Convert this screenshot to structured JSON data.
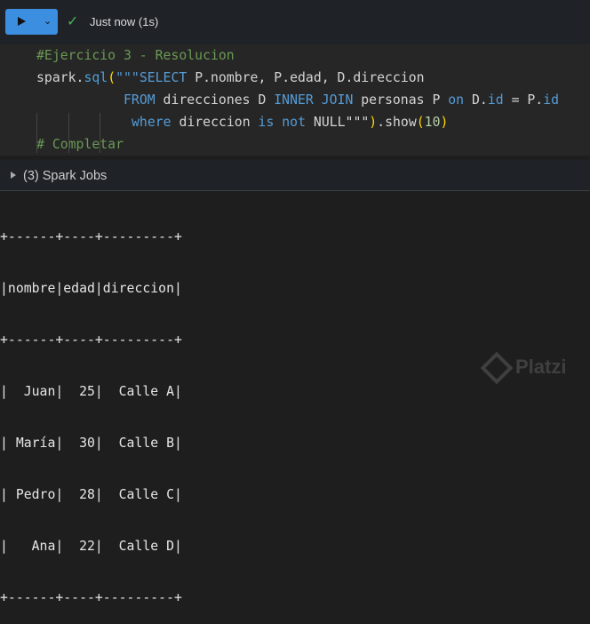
{
  "toolbar": {
    "status": "Just now (1s)",
    "chevron": "⌄",
    "check": "✓"
  },
  "code": {
    "l1": "#Ejercicio 3 - Resolucion",
    "l2a": "spark.",
    "l2b": "sql",
    "l2c": "(",
    "l2d": "\"\"\"SELECT ",
    "l2e": "P.nombre, P.edad, D.direccion",
    "l3a": "FROM ",
    "l3b": "direcciones D ",
    "l3c": "INNER JOIN ",
    "l3d": "personas P ",
    "l3e": "on ",
    "l3f": "D.",
    "l3g": "id",
    " l3h": "",
    "l3i": " = P.",
    "l3j": "id",
    "l4a": "where ",
    "l4b": "direccion ",
    "l4c": "is not ",
    "l4d": "NULL",
    "l4e": "\"\"\"",
    "l4f": ")",
    "l4g": ".show",
    "l4h": "(",
    "l4i": "10",
    "l4j": ")",
    "l5": "# Completar"
  },
  "jobs": {
    "label": "(3) Spark Jobs"
  },
  "output": {
    "lines": [
      "+------+----+---------+",
      "|nombre|edad|direccion|",
      "+------+----+---------+",
      "|  Juan|  25|  Calle A|",
      "| María|  30|  Calle B|",
      "| Pedro|  28|  Calle C|",
      "|   Ana|  22|  Calle D|",
      "+------+----+---------+"
    ]
  },
  "watermark": "Platzi"
}
